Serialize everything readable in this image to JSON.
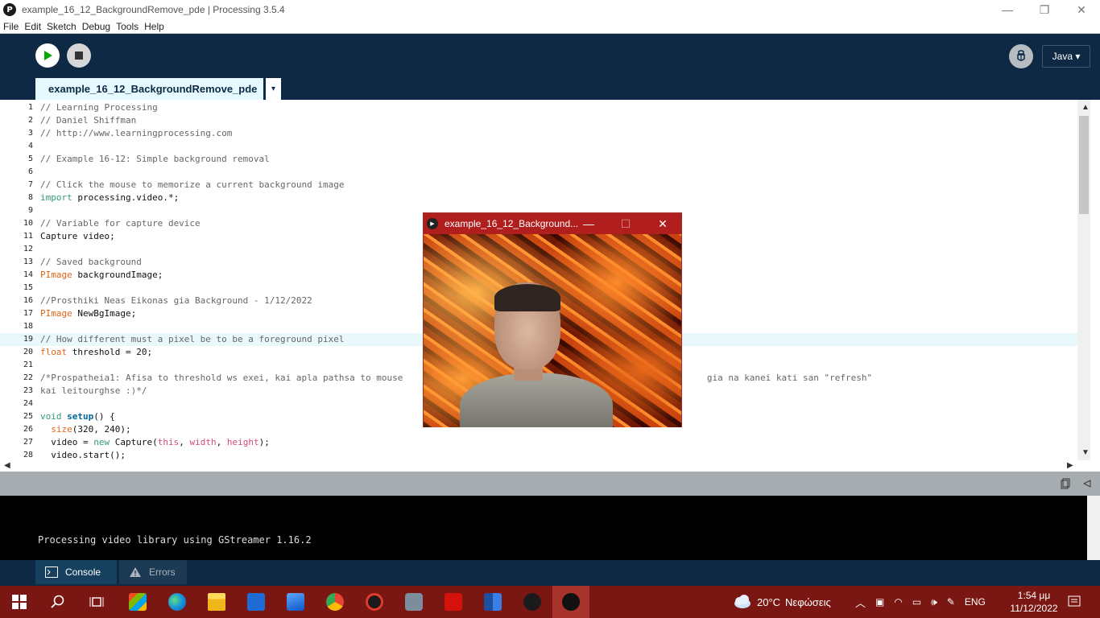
{
  "window": {
    "title": "example_16_12_BackgroundRemove_pde | Processing 3.5.4",
    "minimize": "—",
    "restore": "❐",
    "close": "✕"
  },
  "menu": [
    "File",
    "Edit",
    "Sketch",
    "Debug",
    "Tools",
    "Help"
  ],
  "toolbar": {
    "run_icon": "play-icon",
    "stop_icon": "stop-icon",
    "debug_icon": "debugger-icon",
    "mode": "Java ▾"
  },
  "tab": {
    "name": "example_16_12_BackgroundRemove_pde",
    "menu_arrow": "▾"
  },
  "editor": {
    "current_line": 19,
    "lines": [
      {
        "n": "1",
        "parts": [
          [
            "c",
            "// Learning Processing"
          ]
        ]
      },
      {
        "n": "2",
        "parts": [
          [
            "c",
            "// Daniel Shiffman"
          ]
        ]
      },
      {
        "n": "3",
        "parts": [
          [
            "c",
            "// http://www.learningprocessing.com"
          ]
        ]
      },
      {
        "n": "4",
        "parts": []
      },
      {
        "n": "5",
        "parts": [
          [
            "c",
            "// Example 16-12: Simple background removal"
          ]
        ]
      },
      {
        "n": "6",
        "parts": []
      },
      {
        "n": "7",
        "parts": [
          [
            "c",
            "// Click the mouse to memorize a current background image"
          ]
        ]
      },
      {
        "n": "8",
        "parts": [
          [
            "k",
            "import"
          ],
          [
            "",
            " processing.video.*;"
          ]
        ]
      },
      {
        "n": "9",
        "parts": []
      },
      {
        "n": "10",
        "parts": [
          [
            "c",
            "// Variable for capture device"
          ]
        ]
      },
      {
        "n": "11",
        "parts": [
          [
            "",
            "Capture video;"
          ]
        ]
      },
      {
        "n": "12",
        "parts": []
      },
      {
        "n": "13",
        "parts": [
          [
            "c",
            "// Saved background"
          ]
        ]
      },
      {
        "n": "14",
        "parts": [
          [
            "t",
            "PImage"
          ],
          [
            "",
            " backgroundImage;"
          ]
        ]
      },
      {
        "n": "15",
        "parts": []
      },
      {
        "n": "16",
        "parts": [
          [
            "c",
            "//Prosthiki Neas Eikonas gia Background - 1/12/2022"
          ]
        ]
      },
      {
        "n": "17",
        "parts": [
          [
            "t",
            "PImage"
          ],
          [
            "",
            " NewBgImage;"
          ]
        ]
      },
      {
        "n": "18",
        "parts": []
      },
      {
        "n": "19",
        "parts": [
          [
            "c",
            "// How different must a pixel be to be a foreground pixel"
          ]
        ]
      },
      {
        "n": "20",
        "parts": [
          [
            "t",
            "float"
          ],
          [
            "",
            " threshold = 20;"
          ]
        ]
      },
      {
        "n": "21",
        "parts": []
      },
      {
        "n": "22",
        "parts": [
          [
            "c",
            "/*Prospatheia1: Afisa to threshold ws exei, kai apla pathsa to mouse"
          ],
          [
            "c",
            "                                                         gia na kanei kati san \"refresh\""
          ]
        ]
      },
      {
        "n": "23",
        "parts": [
          [
            "c",
            "kai leitourghse :)*/"
          ]
        ]
      },
      {
        "n": "24",
        "parts": []
      },
      {
        "n": "25",
        "parts": [
          [
            "k",
            "void"
          ],
          [
            "",
            " "
          ],
          [
            "f",
            "setup"
          ],
          [
            "",
            "() {"
          ]
        ]
      },
      {
        "n": "26",
        "parts": [
          [
            "",
            "  "
          ],
          [
            "n",
            "size"
          ],
          [
            "",
            "(320, 240);"
          ]
        ]
      },
      {
        "n": "27",
        "parts": [
          [
            "",
            "  video = "
          ],
          [
            "k",
            "new"
          ],
          [
            "",
            " Capture("
          ],
          [
            "kw2",
            "this"
          ],
          [
            "",
            ", "
          ],
          [
            "kw2",
            "width"
          ],
          [
            "",
            ", "
          ],
          [
            "kw2",
            "height"
          ],
          [
            "",
            ");"
          ]
        ]
      },
      {
        "n": "28",
        "parts": [
          [
            "",
            "  video.start();"
          ]
        ]
      }
    ]
  },
  "sketch_window": {
    "title": "example_16_12_Background...",
    "minimize": "—",
    "maximize": "☐",
    "close": "✕"
  },
  "console": {
    "output": "Processing video library using GStreamer 1.16.2",
    "tabs": [
      {
        "label": "Console",
        "icon": "console-icon"
      },
      {
        "label": "Errors",
        "icon": "warning-icon"
      }
    ]
  },
  "taskbar": {
    "weather_temp": "20°C",
    "weather_text": "Νεφώσεις",
    "language": "ENG",
    "time": "1:54 μμ",
    "date": "11/12/2022"
  }
}
